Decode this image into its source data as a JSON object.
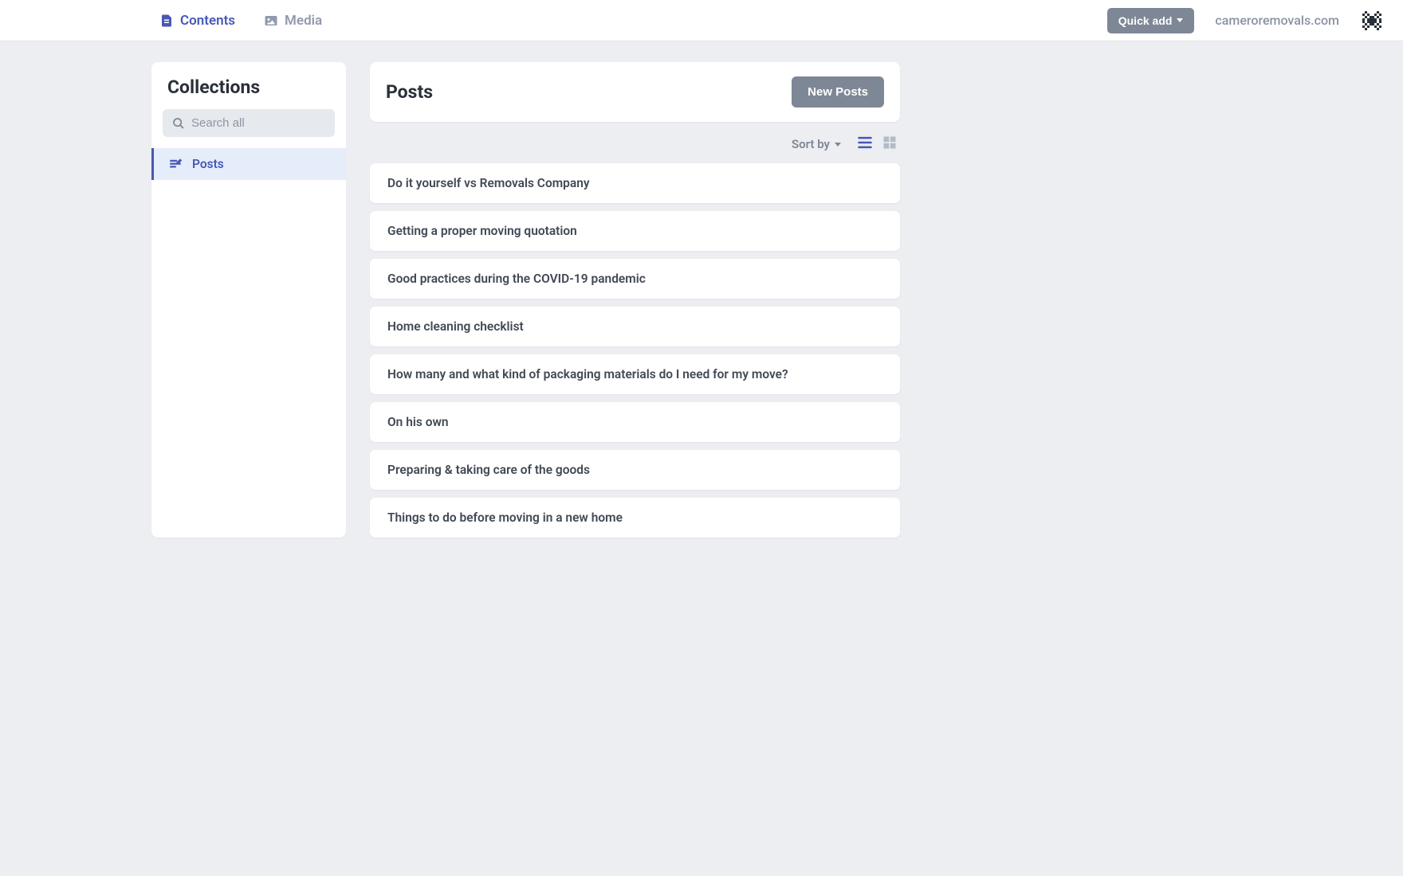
{
  "topbar": {
    "tabs": {
      "contents": "Contents",
      "media": "Media"
    },
    "quick_add": "Quick add",
    "domain": "cameroremovals.com"
  },
  "sidebar": {
    "title": "Collections",
    "search_placeholder": "Search all",
    "items": [
      {
        "label": "Posts"
      }
    ]
  },
  "main": {
    "title": "Posts",
    "new_button": "New Posts",
    "sort_label": "Sort by",
    "posts": [
      {
        "title": "Do it yourself vs Removals Company"
      },
      {
        "title": "Getting a proper moving quotation"
      },
      {
        "title": "Good practices during the COVID-19 pandemic"
      },
      {
        "title": "Home cleaning checklist"
      },
      {
        "title": "How many and what kind of packaging materials do I need for my move?"
      },
      {
        "title": "On his own"
      },
      {
        "title": "Preparing & taking care of the goods"
      },
      {
        "title": "Things to do before moving in a new home"
      }
    ]
  }
}
